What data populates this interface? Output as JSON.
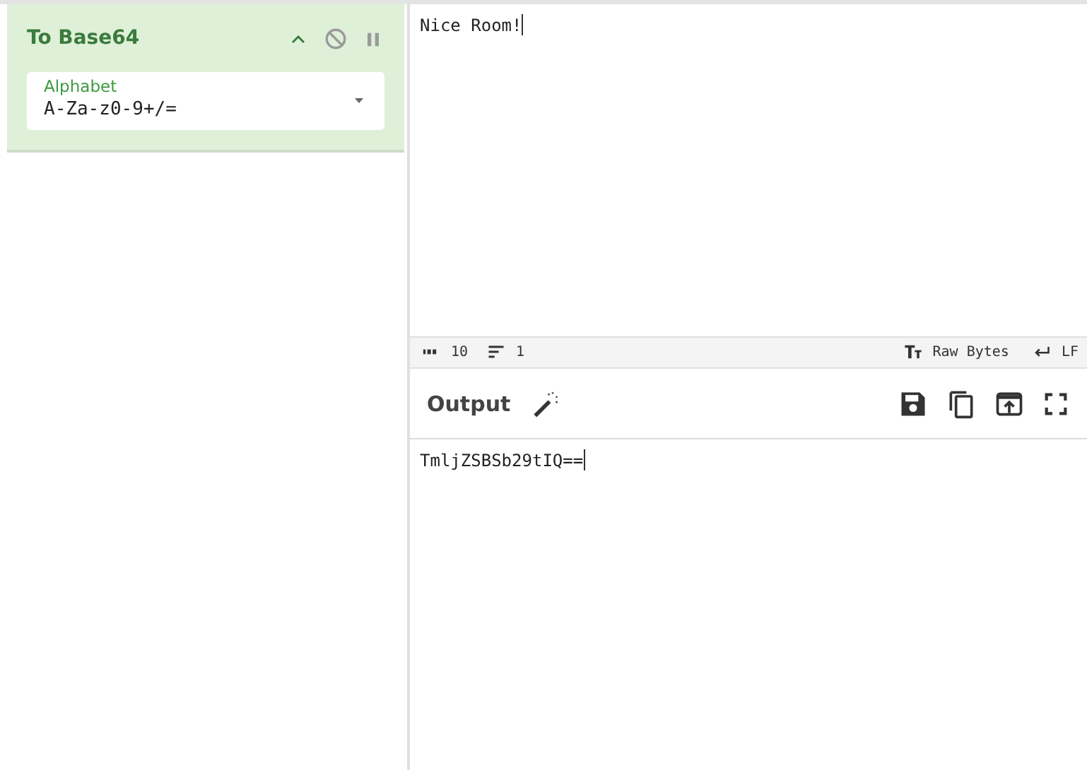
{
  "recipe": {
    "operations": [
      {
        "title": "To Base64",
        "fields": [
          {
            "label": "Alphabet",
            "value": "A-Za-z0-9+/="
          }
        ]
      }
    ]
  },
  "input": {
    "text": "Nice Room!"
  },
  "status_bar": {
    "length": "10",
    "lines": "1",
    "encoding": "Raw Bytes",
    "line_ending": "LF"
  },
  "output": {
    "title": "Output",
    "text": "TmljZSBSb29tIQ=="
  }
}
